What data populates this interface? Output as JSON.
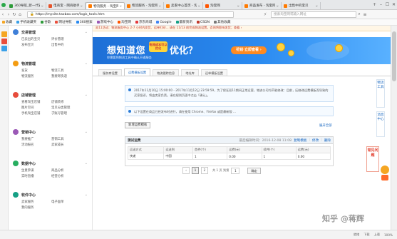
{
  "tabs": [
    {
      "label": "360导航_新一代安全上网导航",
      "color": "#2e9b3a",
      "active": false
    },
    {
      "label": "电商宝 - 网商助手",
      "color": "#e6542b",
      "active": false
    },
    {
      "label": "物流服务 - 淘宝网",
      "color": "#ff7a00",
      "active": true
    },
    {
      "label": "物流服务 - 淘宝网",
      "color": "#ff7a00",
      "active": false
    },
    {
      "label": "卖家中心首页 - 淘宝网",
      "color": "#ff7a00",
      "active": false
    },
    {
      "label": "淘宝网",
      "color": "#ff5500",
      "active": false
    },
    {
      "label": "商品发布 - 淘宝网",
      "color": "#ff7a00",
      "active": false
    },
    {
      "label": "出售中的宝贝",
      "color": "#ff7a00",
      "active": false
    }
  ],
  "address": {
    "url": "https://mysite.taobao.com/logis_tools.htm",
    "search_placeholder": "搜索淘宝网或输入网址"
  },
  "bookmarks": [
    "收藏",
    "手机收藏夹",
    "谷歌",
    "网址导航",
    "360搜索",
    "游戏中心",
    "淘宝网",
    "京东商城",
    "Google",
    "最新资讯",
    "CSDN",
    "其他收藏"
  ],
  "rail_icons": [
    "shield-icon",
    "star-icon",
    "globe-icon"
  ],
  "sidebar": [
    {
      "title": "交易管理",
      "color": "#3f7fd8",
      "items": [
        "已卖出的宝贝",
        "评价管理",
        "发布宝贝",
        "出售中的"
      ]
    },
    {
      "title": "物流管理",
      "color": "#f39c12",
      "items": [
        "发货",
        "物流工具",
        "物流服务",
        "我要寄快递"
      ]
    },
    {
      "title": "店铺管理",
      "color": "#e74c3c",
      "items": [
        "查看淘宝店铺",
        "店铺装修",
        "图片空间",
        "宝贝分类管理",
        "手机淘宝店铺",
        "子账号管理"
      ]
    },
    {
      "title": "营销中心",
      "color": "#9b59b6",
      "items": [
        "我要推广",
        "营销工具",
        "活动报名",
        "卖家成长"
      ]
    },
    {
      "title": "数据中心",
      "color": "#27ae60",
      "items": [
        "生意参谋",
        "商品分析",
        "实时直播",
        "经营分析"
      ]
    },
    {
      "title": "软件中心",
      "color": "#16a085",
      "items": [
        "卖家服务",
        "电子面单",
        "我的服务"
      ]
    }
  ],
  "notice": "双11活动：物流服务中心 2-7 小时内发货、运单打印... 请在 11/13 前完成物流设置，否则将影响发货；查看 ›",
  "banner": {
    "title": "想知道您",
    "badge": "物流成本可以 优化",
    "title2": "优化？",
    "subtitle": "你需要到物流工具中确认开通服务",
    "button": "花钱·立即查看 ›"
  },
  "subtabs": [
    "服务商设置",
    "运费模板设置",
    "物流跟踪信息",
    "地址库",
    "运单模板设置"
  ],
  "active_subtab": 1,
  "info1": "2017年11月10日 15:00:00 - 2017年11月12日 23:59:59，为了保证双11期间正常运营，物流公司均不能修改：目前，因修改运费模板而导致的买家投诉，将由卖家负责。请在规则页面中点击「确认」。",
  "info2": "以下设置在商品已经发布时进行，请在使用 Chrome、Firefox 或是最新版 ...",
  "add_button": "新增运费模板",
  "collapse_link": "展开全部",
  "template": {
    "name": "测试运费",
    "modified": "最后编辑时间：2016-12-08 11:08",
    "actions": [
      "复制模板",
      "修改",
      "删除"
    ],
    "headers": [
      "运送方式",
      "运送到",
      "首件(个)",
      "运费(元)",
      "续件(个)",
      "运费(元)"
    ],
    "rows": [
      [
        "快递",
        "中国",
        "1",
        "0.00",
        "1",
        "0.00"
      ]
    ]
  },
  "pagination": {
    "pages": [
      "1",
      "2"
    ],
    "current": "1",
    "total": "共 1 页 到第",
    "input_value": "1",
    "go": "确定"
  },
  "right_float": {
    "a": "物流工具",
    "b": "消息中心",
    "red": "常见问题"
  },
  "status": [
    "就绪",
    "100%",
    "下载",
    "上载"
  ],
  "watermark": "知乎 @蒋辉"
}
